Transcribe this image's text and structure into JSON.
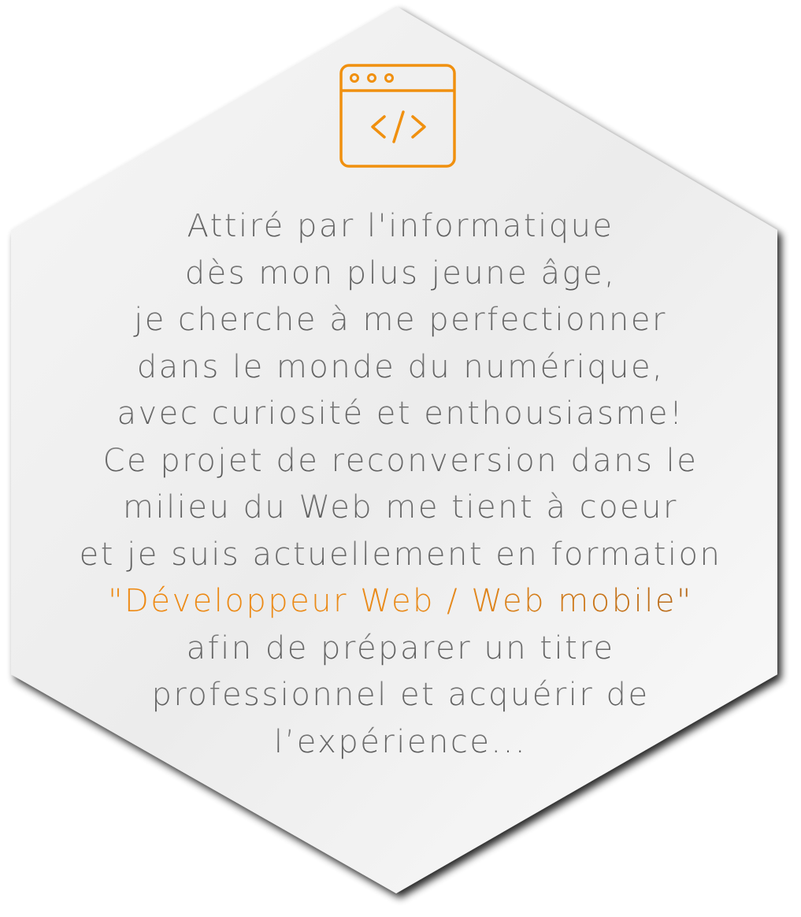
{
  "colors": {
    "accent": "#F0900F",
    "text": "#5C5C5C",
    "hexagon_fill": "#EFEFEF"
  },
  "icon": {
    "name": "code-window-icon"
  },
  "paragraph": {
    "lines": [
      "Attiré par l'informatique",
      "dès mon plus jeune âge,",
      "je cherche à me perfectionner",
      "dans le monde du numérique,",
      "avec curiosité et enthousiasme!",
      "Ce projet de reconversion dans le",
      "milieu du Web me tient à coeur",
      "et je suis actuellement en formation",
      "\"Développeur Web / Web mobile\"",
      "afin de préparer un titre",
      "professionnel et acquérir de",
      "l’expérience..."
    ]
  }
}
